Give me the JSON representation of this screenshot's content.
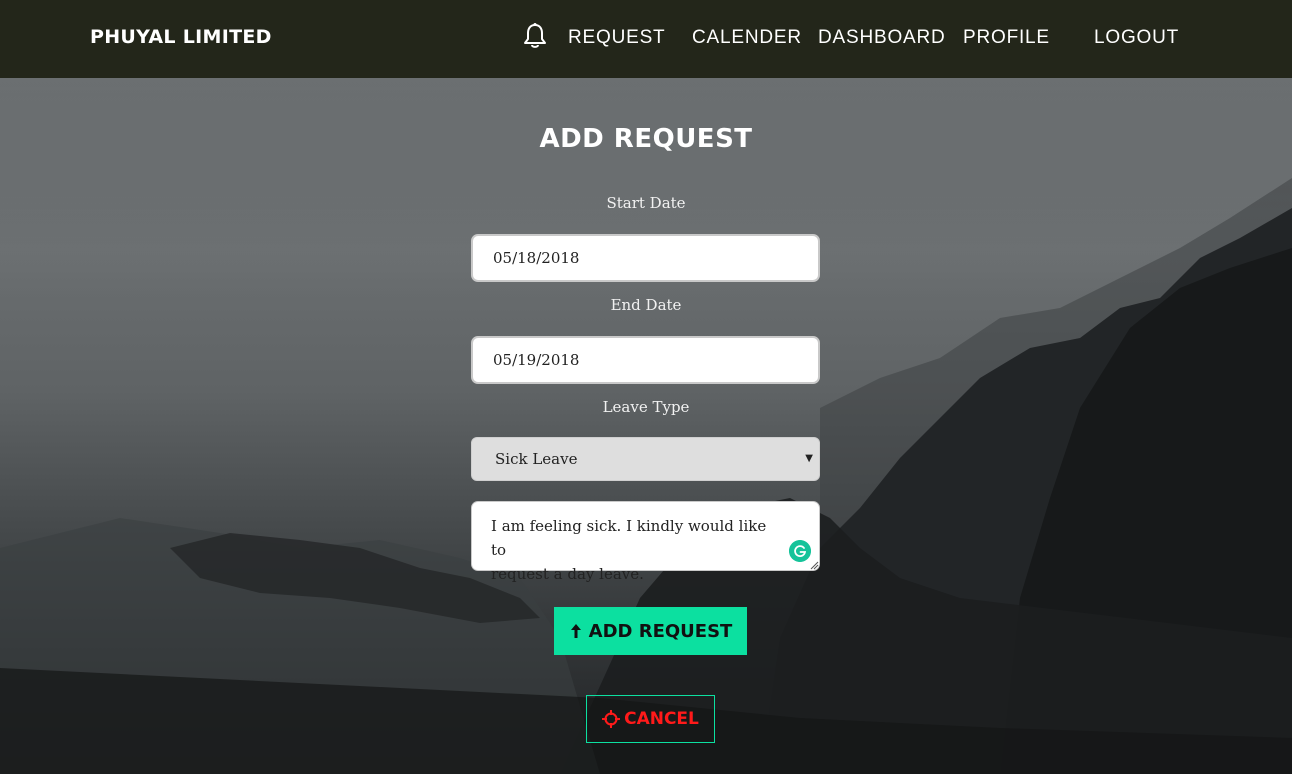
{
  "navbar": {
    "brand": "PHUYAL LIMITED",
    "items": [
      {
        "label": "REQUEST"
      },
      {
        "label": "CALENDER"
      },
      {
        "label": "DASHBOARD"
      },
      {
        "label": "PROFILE"
      },
      {
        "label": "LOGOUT"
      }
    ],
    "notification_icon": "bell-icon"
  },
  "form": {
    "title": "ADD REQUEST",
    "start_date_label": "Start Date",
    "start_date_value": "05/18/2018",
    "end_date_label": "End Date",
    "end_date_value": "05/19/2018",
    "leave_type_label": "Leave Type",
    "leave_type_value": "Sick Leave",
    "reason_line1": "I am feeling sick. I kindly would like to",
    "reason_line2": "request a day leave.",
    "submit_label": "ADD REQUEST",
    "submit_icon": "upload-arrow-icon",
    "cancel_label": "CANCEL",
    "cancel_icon": "crosshair-icon"
  },
  "colors": {
    "navbar_bg": "#23261a",
    "accent": "#0ce0a0",
    "cancel_text": "#ff1a1a"
  }
}
